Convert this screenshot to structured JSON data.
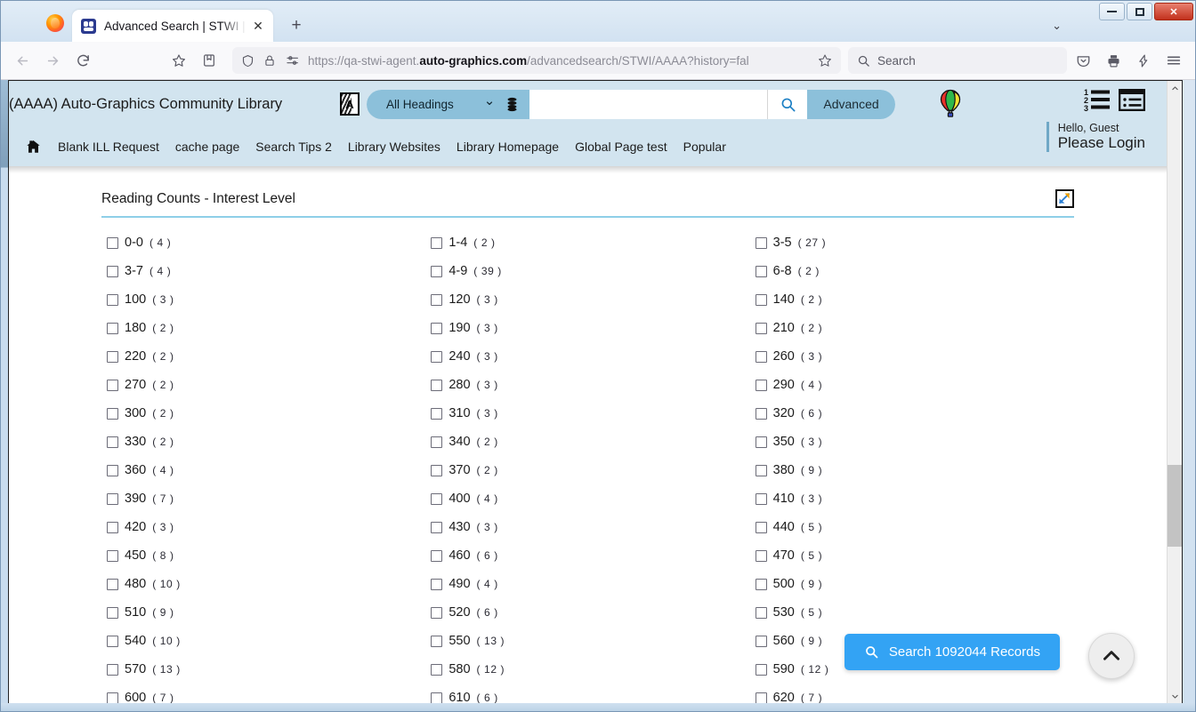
{
  "browser": {
    "tab": {
      "title": "Advanced Search | STWI | AAAA",
      "close_label": "✕",
      "favicon_name": "stwi-favicon"
    },
    "new_tab_label": "+",
    "tab_list_chevron": "⌄",
    "window_controls": {
      "minimize": "minimize",
      "maximize": "maximize",
      "close": "✕"
    },
    "url": {
      "prefix": "https://qa-stwi-agent.",
      "domain": "auto-graphics.com",
      "suffix": "/advancedsearch/STWI/AAAA?history=fal"
    },
    "search_placeholder": "Search",
    "toolbar_icons": [
      "back-icon",
      "forward-icon",
      "reload-icon",
      "bookmark-star-icon",
      "save-to-pocket-list-icon",
      "shield-icon",
      "lock-icon",
      "permissions-icon",
      "star-icon",
      "pocket-icon",
      "print-icon",
      "share-icon",
      "hamburger-menu-icon"
    ]
  },
  "site": {
    "library_name": "(AAAA) Auto-Graphics Community Library",
    "language_icon_letter": "A",
    "search": {
      "scope_value": "All Headings",
      "scope_chevron": "⌄",
      "input_value": "",
      "advanced_label": "Advanced"
    },
    "user": {
      "greeting": "Hello, Guest",
      "login_label": "Please Login"
    },
    "nav_links": [
      "Blank ILL Request",
      "cache page",
      "Search Tips 2",
      "Library Websites",
      "Library Homepage",
      "Global Page test",
      "Popular"
    ]
  },
  "facet": {
    "title": "Reading Counts - Interest Level",
    "expand_icon_name": "expand-diagonal-icon",
    "items": [
      {
        "label": "0-0",
        "count": "( 4 )"
      },
      {
        "label": "3-7",
        "count": "( 4 )"
      },
      {
        "label": "100",
        "count": "( 3 )"
      },
      {
        "label": "180",
        "count": "( 2 )"
      },
      {
        "label": "220",
        "count": "( 2 )"
      },
      {
        "label": "270",
        "count": "( 2 )"
      },
      {
        "label": "300",
        "count": "( 2 )"
      },
      {
        "label": "330",
        "count": "( 2 )"
      },
      {
        "label": "360",
        "count": "( 4 )"
      },
      {
        "label": "390",
        "count": "( 7 )"
      },
      {
        "label": "420",
        "count": "( 3 )"
      },
      {
        "label": "450",
        "count": "( 8 )"
      },
      {
        "label": "480",
        "count": "( 10 )"
      },
      {
        "label": "510",
        "count": "( 9 )"
      },
      {
        "label": "540",
        "count": "( 10 )"
      },
      {
        "label": "570",
        "count": "( 13 )"
      },
      {
        "label": "600",
        "count": "( 7 )"
      },
      {
        "label": "1-4",
        "count": "( 2 )"
      },
      {
        "label": "4-9",
        "count": "( 39 )"
      },
      {
        "label": "120",
        "count": "( 3 )"
      },
      {
        "label": "190",
        "count": "( 3 )"
      },
      {
        "label": "240",
        "count": "( 3 )"
      },
      {
        "label": "280",
        "count": "( 3 )"
      },
      {
        "label": "310",
        "count": "( 3 )"
      },
      {
        "label": "340",
        "count": "( 2 )"
      },
      {
        "label": "370",
        "count": "( 2 )"
      },
      {
        "label": "400",
        "count": "( 4 )"
      },
      {
        "label": "430",
        "count": "( 3 )"
      },
      {
        "label": "460",
        "count": "( 6 )"
      },
      {
        "label": "490",
        "count": "( 4 )"
      },
      {
        "label": "520",
        "count": "( 6 )"
      },
      {
        "label": "550",
        "count": "( 13 )"
      },
      {
        "label": "580",
        "count": "( 12 )"
      },
      {
        "label": "610",
        "count": "( 6 )"
      },
      {
        "label": "3-5",
        "count": "( 27 )"
      },
      {
        "label": "6-8",
        "count": "( 2 )"
      },
      {
        "label": "140",
        "count": "( 2 )"
      },
      {
        "label": "210",
        "count": "( 2 )"
      },
      {
        "label": "260",
        "count": "( 3 )"
      },
      {
        "label": "290",
        "count": "( 4 )"
      },
      {
        "label": "320",
        "count": "( 6 )"
      },
      {
        "label": "350",
        "count": "( 3 )"
      },
      {
        "label": "380",
        "count": "( 9 )"
      },
      {
        "label": "410",
        "count": "( 3 )"
      },
      {
        "label": "440",
        "count": "( 5 )"
      },
      {
        "label": "470",
        "count": "( 5 )"
      },
      {
        "label": "500",
        "count": "( 9 )"
      },
      {
        "label": "530",
        "count": "( 5 )"
      },
      {
        "label": "560",
        "count": "( 9 )"
      },
      {
        "label": "590",
        "count": "( 12 )"
      },
      {
        "label": "620",
        "count": "( 7 )"
      }
    ]
  },
  "actions": {
    "search_records_label": "Search 1092044 Records",
    "search_records_icon": "search-icon",
    "to_top_icon": "chevron-up-icon"
  },
  "colors": {
    "header_bg": "#d2e4ef",
    "accent_blue": "#8cc0da",
    "facet_rule": "#8ecfe8",
    "primary_button": "#33a3f4"
  }
}
